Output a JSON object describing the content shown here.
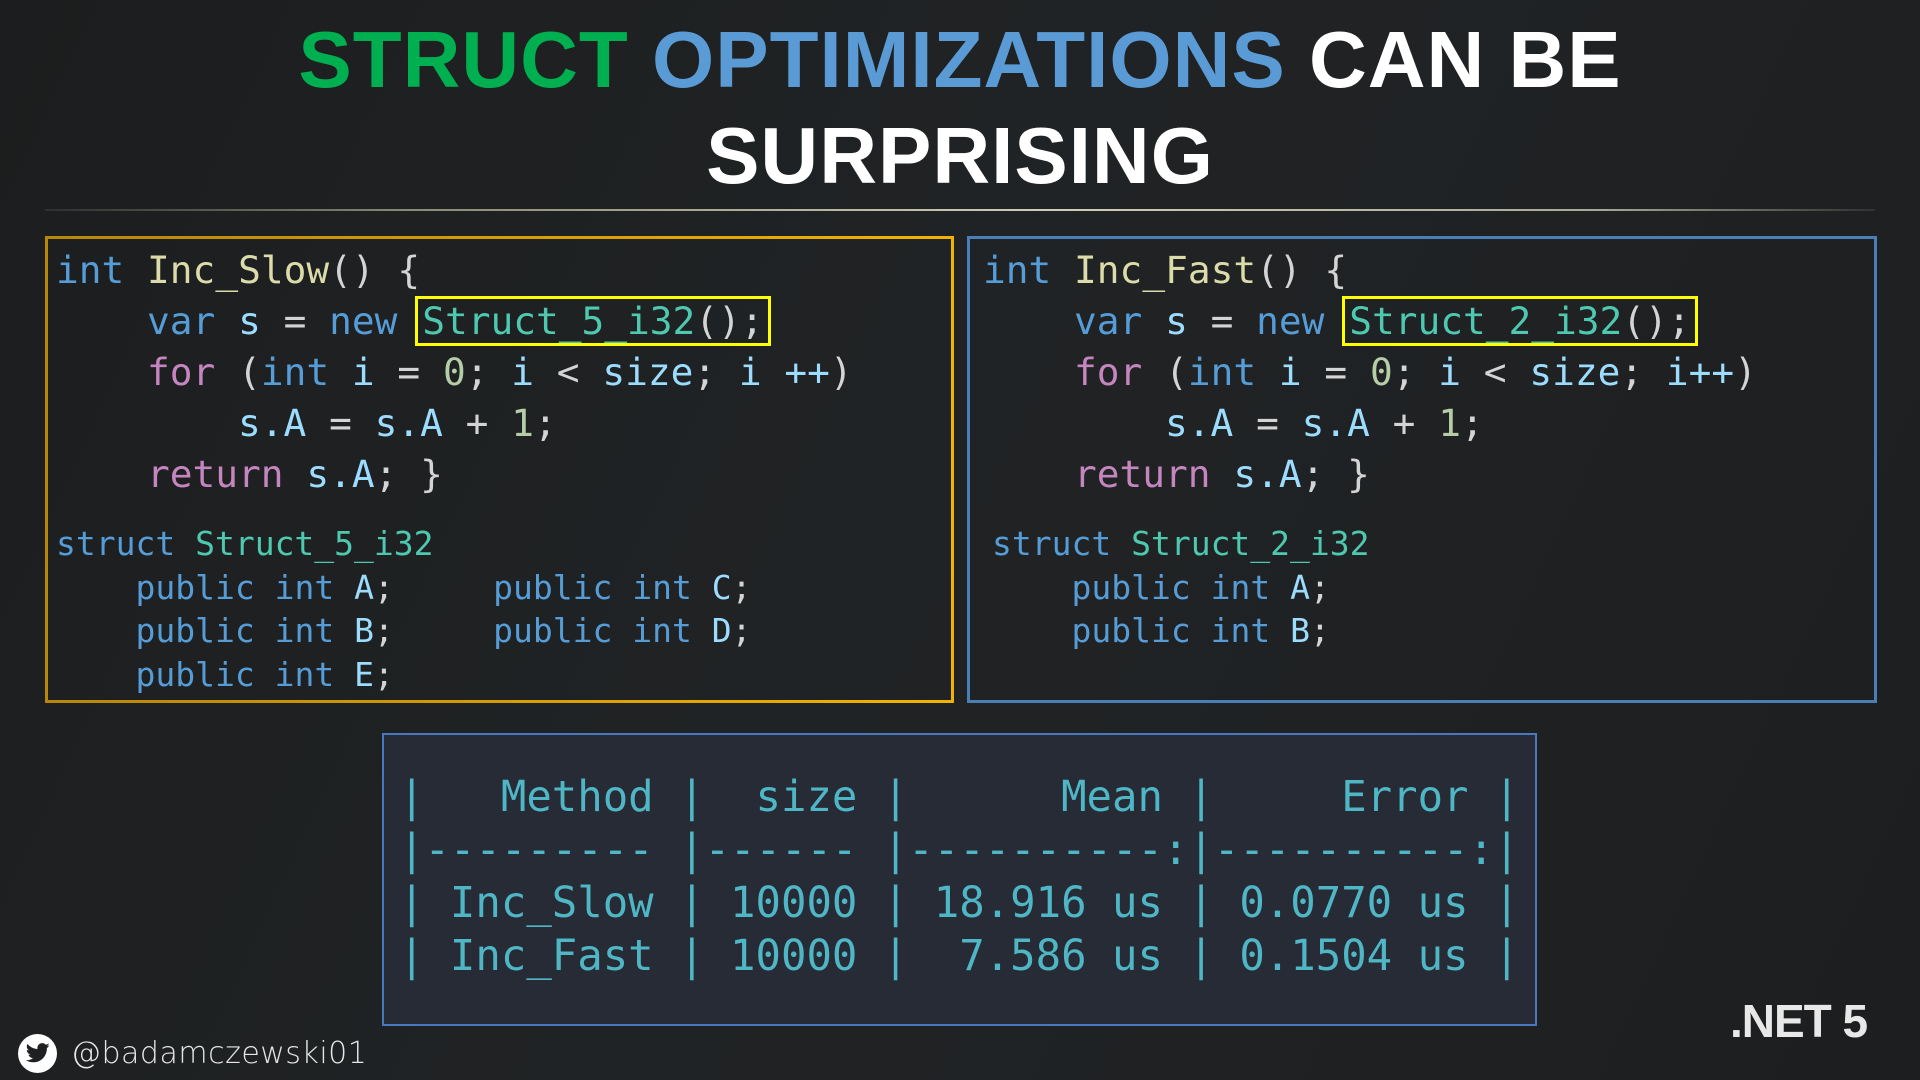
{
  "title": {
    "line1": [
      {
        "text": "STRUCT",
        "color": "#00b050"
      },
      {
        "text": "OPTIMIZATIONS",
        "color": "#5b9bd5"
      },
      {
        "text": "CAN BE",
        "color": "#ffffff"
      }
    ],
    "line2": "SURPRISING"
  },
  "left_panel": {
    "border_color": "#e0a800",
    "method": {
      "return_type": "int",
      "name": "Inc_Slow",
      "signature_tail": "() {",
      "var_kw": "var",
      "var_name": "s",
      "eq": "=",
      "new_kw": "new",
      "highlighted_ctor": "Struct_5_i32",
      "ctor_tail": "();",
      "for_kw": "for",
      "loop_int": "int",
      "loop_var": "i",
      "loop_init": "0",
      "loop_limit": "size",
      "loop_inc": "i ++",
      "body_lhs": "s.A",
      "body_rhs": "s.A",
      "body_add": "1",
      "return_kw": "return",
      "return_expr": "s.A",
      "close": "}"
    },
    "struct": {
      "keyword": "struct",
      "name": "Struct_5_i32",
      "fields": [
        {
          "mod": "public",
          "type": "int",
          "name": "A"
        },
        {
          "mod": "public",
          "type": "int",
          "name": "B"
        },
        {
          "mod": "public",
          "type": "int",
          "name": "E"
        },
        {
          "mod": "public",
          "type": "int",
          "name": "C"
        },
        {
          "mod": "public",
          "type": "int",
          "name": "D"
        }
      ]
    }
  },
  "right_panel": {
    "border_color": "#4a7fb5",
    "method": {
      "return_type": "int",
      "name": "Inc_Fast",
      "signature_tail": "() {",
      "var_kw": "var",
      "var_name": "s",
      "eq": "=",
      "new_kw": "new",
      "highlighted_ctor": "Struct_2_i32",
      "ctor_tail": "();",
      "for_kw": "for",
      "loop_int": "int",
      "loop_var": "i",
      "loop_init": "0",
      "loop_limit": "size",
      "loop_inc": "i++",
      "body_lhs": "s.A",
      "body_rhs": "s.A",
      "body_add": "1",
      "return_kw": "return",
      "return_expr": "s.A",
      "close": "}"
    },
    "struct": {
      "keyword": "struct",
      "name": "Struct_2_i32",
      "fields": [
        {
          "mod": "public",
          "type": "int",
          "name": "A"
        },
        {
          "mod": "public",
          "type": "int",
          "name": "B"
        }
      ]
    }
  },
  "results_table": {
    "columns": [
      "Method",
      "size",
      "Mean",
      "Error"
    ],
    "separator": "|--------- |------ |----------:|----------:|",
    "rows": [
      {
        "Method": "Inc_Slow",
        "size": "10000",
        "Mean": "18.916 us",
        "Error": "0.0770 us"
      },
      {
        "Method": "Inc_Fast",
        "size": "10000",
        "Mean": "7.586 us",
        "Error": "0.1504 us"
      }
    ]
  },
  "footer": {
    "icon": "twitter-icon",
    "handle": "@badamczewski01",
    "badge": ".NET 5"
  },
  "colors": {
    "title_green": "#00b050",
    "title_blue": "#5b9bd5",
    "highlight": "#ffff00",
    "table_text": "#4fb6c6",
    "table_bg": "#272b35"
  }
}
